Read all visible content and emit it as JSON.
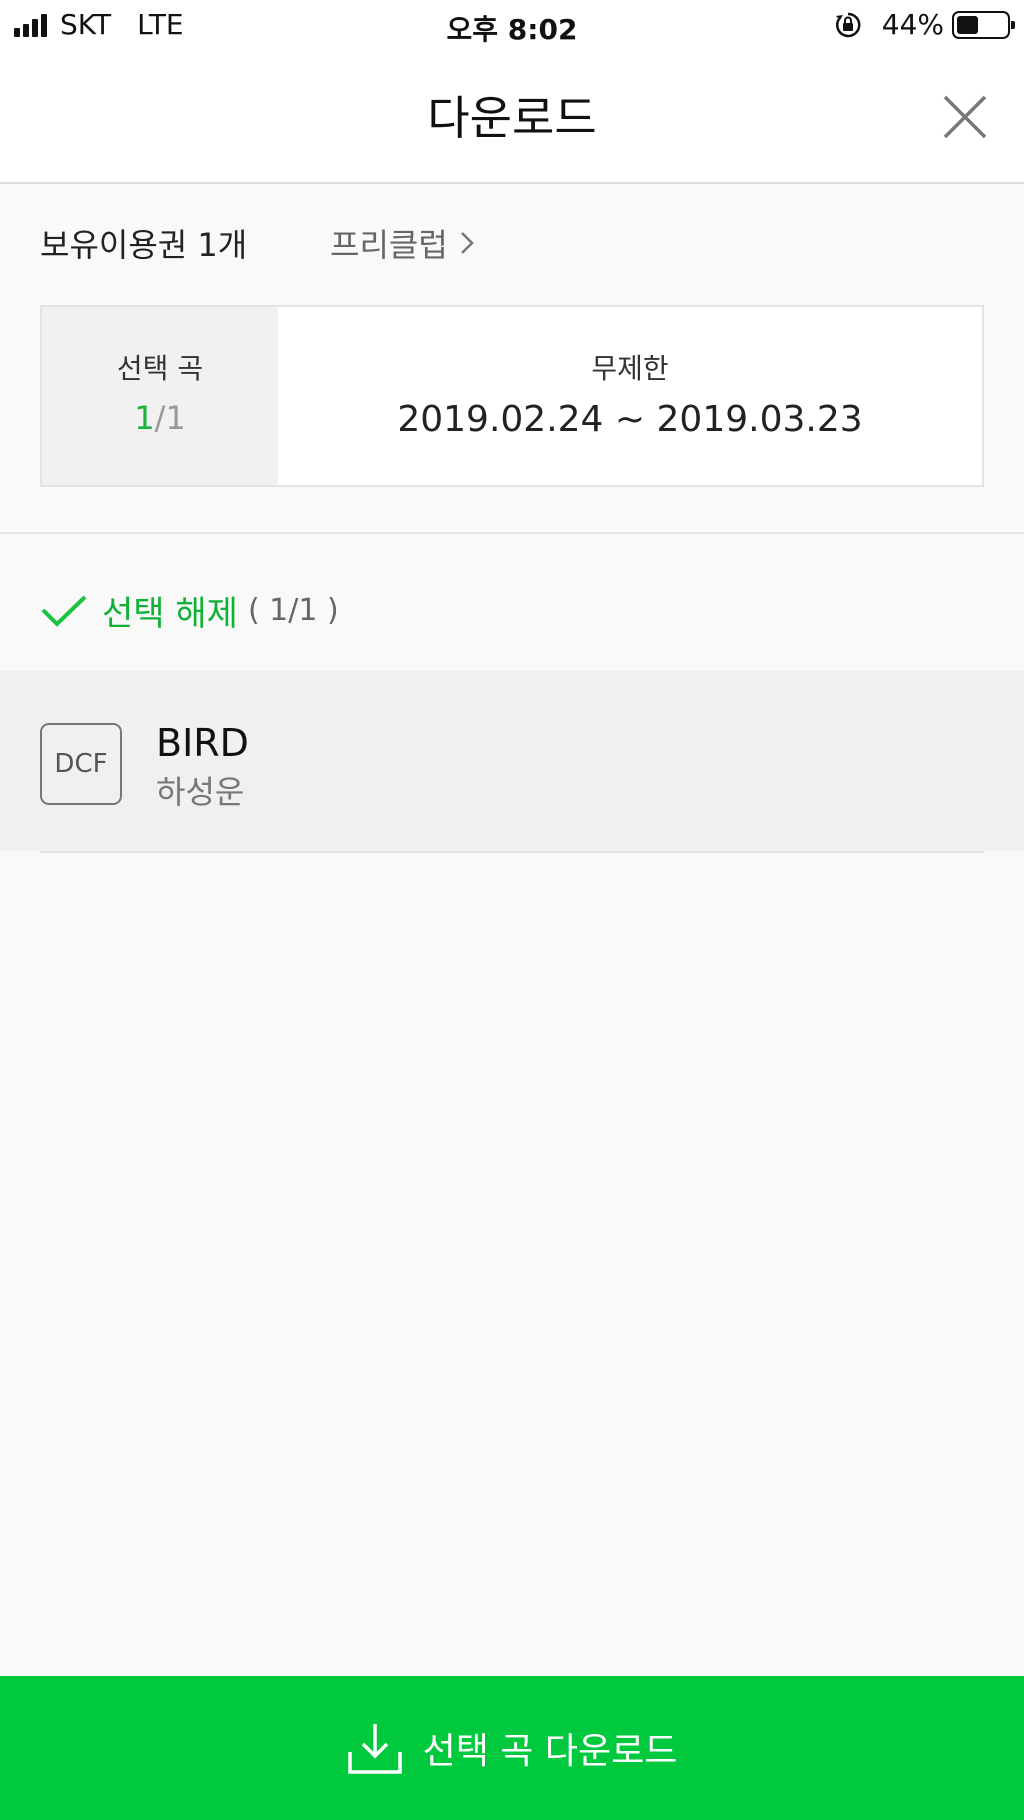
{
  "status_bar": {
    "carrier": "SKT",
    "network": "LTE",
    "time": "오후 8:02",
    "battery": "44%",
    "battery_level_percent": 44
  },
  "header": {
    "title": "다운로드"
  },
  "voucher": {
    "owned": "보유이용권 1개",
    "link": "프리클럽"
  },
  "info": {
    "selected_label": "선택 곡",
    "selected_count": "1",
    "selected_total": "/1",
    "plan_label": "무제한",
    "period": "2019.02.24 ~ 2019.03.23"
  },
  "selection": {
    "toggle_label": "선택 해제",
    "counter": "( 1/1 )"
  },
  "tracks": [
    {
      "badge": "DCF",
      "title": "BIRD",
      "artist": "하성운"
    }
  ],
  "download_button": {
    "label": "선택 곡 다운로드"
  },
  "colors": {
    "accent_green": "#00c93d",
    "text_green": "#0fb236"
  },
  "icons": [
    "signal-icon",
    "rotation-lock-icon",
    "battery-icon",
    "close-icon",
    "chevron-right-icon",
    "check-icon",
    "download-icon"
  ]
}
